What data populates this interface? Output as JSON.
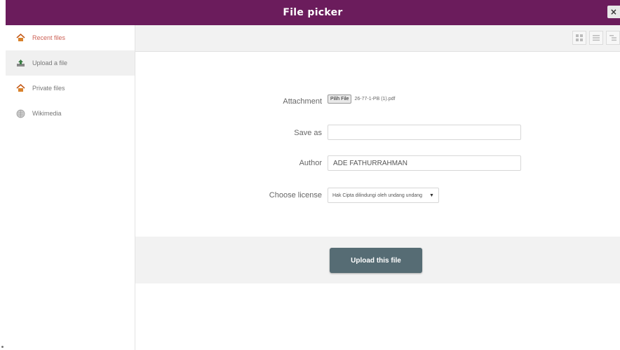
{
  "window": {
    "title": "File picker",
    "close_glyph": "×"
  },
  "sidebar": {
    "items": [
      {
        "label": "Recent files",
        "icon": "recent-files-icon"
      },
      {
        "label": "Upload a file",
        "icon": "upload-icon"
      },
      {
        "label": "Private files",
        "icon": "private-files-icon"
      },
      {
        "label": "Wikimedia",
        "icon": "wikimedia-icon"
      }
    ],
    "active_index": 1
  },
  "toolbar": {
    "view_buttons": [
      "grid-view-icon",
      "list-view-icon",
      "tree-view-icon"
    ]
  },
  "form": {
    "attachment": {
      "label": "Attachment",
      "button": "Pilih File",
      "file_name": "26-77-1-PB (1).pdf"
    },
    "save_as": {
      "label": "Save as",
      "value": ""
    },
    "author": {
      "label": "Author",
      "value": "ADE FATHURRAHMAN"
    },
    "license": {
      "label": "Choose license",
      "value": "Hak Cipta dilindungi oleh undang undang"
    }
  },
  "actions": {
    "upload_label": "Upload this file"
  },
  "colors": {
    "titlebar": "#6b1c5c",
    "upload_button": "#566c74",
    "panel_bg": "#f2f2f2"
  }
}
